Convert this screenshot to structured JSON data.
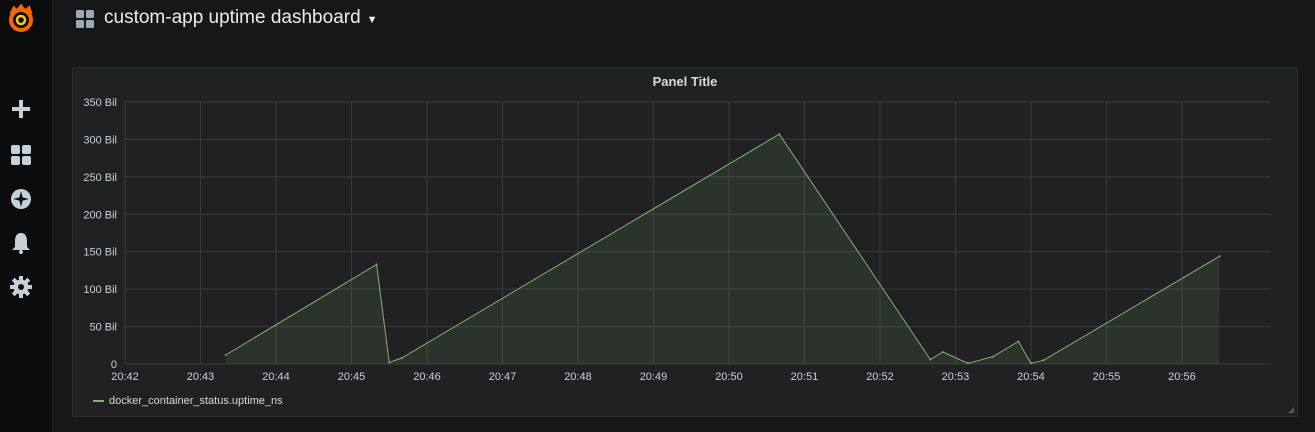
{
  "header": {
    "title": "custom-app uptime dashboard",
    "dashboard_icon": "dashboard-grid-icon",
    "caret_icon": "caret-down-icon"
  },
  "sidebar": {
    "logo_icon": "grafana-logo-icon",
    "items": [
      {
        "icon": "plus-icon",
        "name": "create"
      },
      {
        "icon": "dashboards-icon",
        "name": "dashboards"
      },
      {
        "icon": "explore-compass-icon",
        "name": "explore"
      },
      {
        "icon": "alerting-bell-icon",
        "name": "alerting"
      },
      {
        "icon": "configuration-gear-icon",
        "name": "configuration"
      }
    ]
  },
  "panel": {
    "title": "Panel Title"
  },
  "colors": {
    "series": "#7eb26d",
    "background": "#161719",
    "panel": "#212124",
    "grid": "#3a3b3e",
    "logo": "#f46800"
  },
  "chart_data": {
    "type": "area",
    "title": "Panel Title",
    "xlabel": "",
    "ylabel": "",
    "x_ticks": [
      "20:42",
      "20:43",
      "20:44",
      "20:45",
      "20:46",
      "20:47",
      "20:48",
      "20:49",
      "20:50",
      "20:51",
      "20:52",
      "20:53",
      "20:54",
      "20:55",
      "20:56"
    ],
    "y_ticks": [
      "0",
      "50 Bil",
      "100 Bil",
      "150 Bil",
      "200 Bil",
      "250 Bil",
      "300 Bil",
      "350 Bil"
    ],
    "ylim": [
      0,
      350
    ],
    "y_unit": "Bil",
    "grid": true,
    "legend_position": "bottom-left",
    "series": [
      {
        "name": "docker_container_status.uptime_ns",
        "points": [
          {
            "x": "20:43:20",
            "y": 12
          },
          {
            "x": "20:45:20",
            "y": 133
          },
          {
            "x": "20:45:30",
            "y": 2
          },
          {
            "x": "20:45:40",
            "y": 8
          },
          {
            "x": "20:50:40",
            "y": 307
          },
          {
            "x": "20:52:40",
            "y": 6
          },
          {
            "x": "20:52:50",
            "y": 16
          },
          {
            "x": "20:53:10",
            "y": 1
          },
          {
            "x": "20:53:30",
            "y": 10
          },
          {
            "x": "20:53:50",
            "y": 30
          },
          {
            "x": "20:54:00",
            "y": 1
          },
          {
            "x": "20:54:10",
            "y": 5
          },
          {
            "x": "20:56:30",
            "y": 144
          }
        ]
      }
    ]
  }
}
